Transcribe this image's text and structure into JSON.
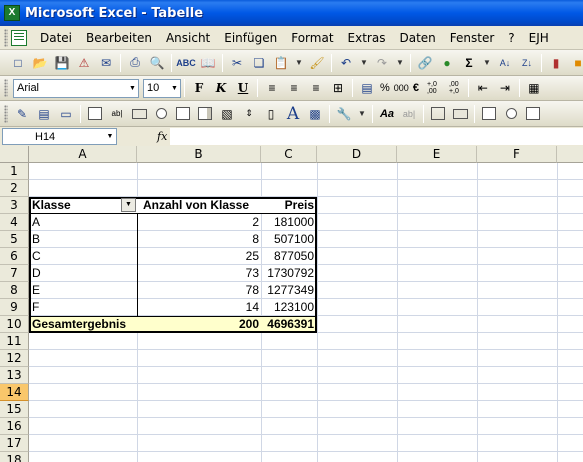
{
  "window": {
    "title": "Microsoft Excel - Tabelle",
    "app_icon": "X"
  },
  "menu": [
    "Datei",
    "Bearbeiten",
    "Ansicht",
    "Einfügen",
    "Format",
    "Extras",
    "Daten",
    "Fenster",
    "?",
    "EJH"
  ],
  "format_toolbar": {
    "font_name": "Arial",
    "font_size": "10",
    "bold": "F",
    "italic": "K",
    "underline": "U",
    "percent": "%",
    "thousands": "000",
    "euro": "€",
    "inc_decimal": "+,0\n,00",
    "dec_decimal": ",00\n+,0"
  },
  "forms_toolbar": {
    "big_a": "A",
    "aa_label": "Aa",
    "ab_label": "ab|"
  },
  "formula_bar": {
    "name_box": "H14",
    "fx": "fx",
    "formula": ""
  },
  "sheet": {
    "columns": [
      "A",
      "B",
      "C",
      "D",
      "E",
      "F"
    ],
    "rows": [
      "1",
      "2",
      "3",
      "4",
      "5",
      "6",
      "7",
      "8",
      "9",
      "10",
      "11",
      "12",
      "13",
      "14",
      "15",
      "16",
      "17",
      "18"
    ],
    "active_row": "14"
  },
  "pivot": {
    "headers": [
      "Klasse",
      "Anzahl von Klasse",
      "Preis"
    ],
    "rows": [
      [
        "A",
        "2",
        "181000"
      ],
      [
        "B",
        "8",
        "507100"
      ],
      [
        "C",
        "25",
        "877050"
      ],
      [
        "D",
        "73",
        "1730792"
      ],
      [
        "E",
        "78",
        "1277349"
      ],
      [
        "F",
        "14",
        "123100"
      ]
    ],
    "total": [
      "Gesamtergebnis",
      "200",
      "4696391"
    ],
    "total_color": "#ffffcc"
  },
  "colors": {
    "titlebar": "#0058e6",
    "active_row_header": "#f9c76b"
  }
}
